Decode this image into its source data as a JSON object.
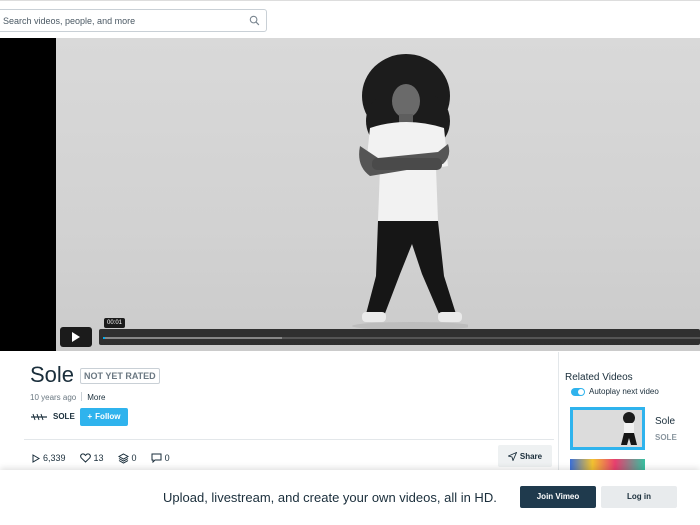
{
  "header": {
    "search_placeholder": "Search videos, people, and more"
  },
  "player": {
    "current_time": "00:01",
    "progress_fraction": 0.003,
    "loaded_fraction": 0.3
  },
  "video": {
    "title": "Sole",
    "rating": "NOT YET RATED",
    "age": "10 years ago",
    "more_label": "More",
    "owner": "SOLE",
    "follow_label": "Follow",
    "plays": "6,339",
    "likes": "13",
    "collections": "0",
    "comments": "0",
    "share_label": "Share"
  },
  "related": {
    "heading": "Related Videos",
    "autoplay_label": "Autoplay next video",
    "autoplay_on": true,
    "items": [
      {
        "title": "Sole",
        "owner": "SOLE"
      }
    ]
  },
  "banner": {
    "text": "Upload, livestream, and create your own videos, all in HD.",
    "join_label": "Join Vimeo",
    "login_label": "Log in"
  },
  "colors": {
    "accent": "#2fb3ed",
    "progress": "#00adef",
    "dark_button": "#1f3a4d",
    "text": "#1a2e3b"
  }
}
